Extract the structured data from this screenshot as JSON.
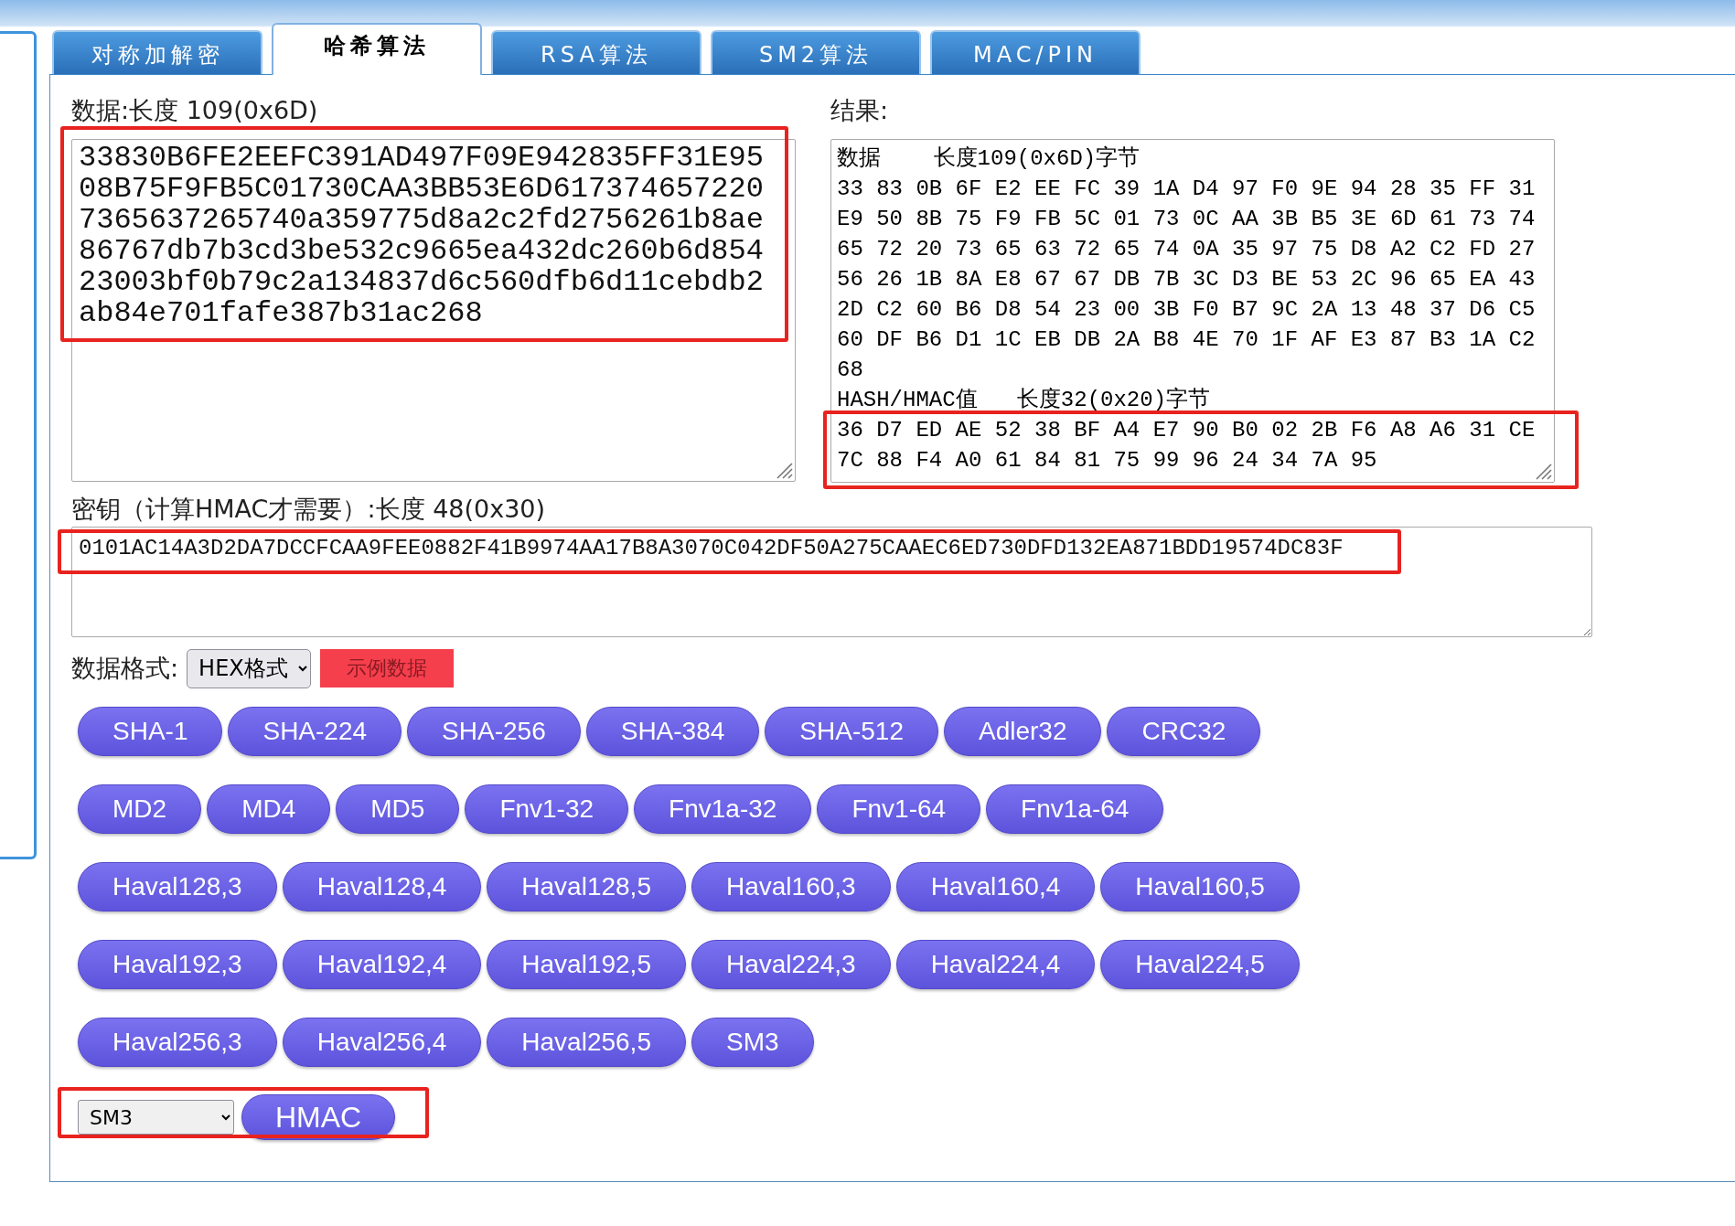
{
  "tabs": [
    {
      "label": "对称加解密",
      "selected": false
    },
    {
      "label": "哈希算法",
      "selected": true
    },
    {
      "label": "RSA算法",
      "selected": false
    },
    {
      "label": "SM2算法",
      "selected": false
    },
    {
      "label": "MAC/PIN",
      "selected": false
    }
  ],
  "data": {
    "label": "数据:长度 109(0x6D)",
    "value": "33830B6FE2EEFC391AD497F09E942835FF31E9508B75F9FB5C01730CAA3BB53E6D6173746572207365637265740a359775d8a2c2fd2756261b8ae86767db7b3cd3be532c9665ea432dc260b6d85423003bf0b79c2a134837d6c560dfb6d11cebdb2ab84e701fafe387b31ac268",
    "highlighted": true
  },
  "result": {
    "label": "结果:",
    "data_header": "数据    长度109(0x6D)字节",
    "data_lines": [
      "33 83 0B 6F E2 EE FC 39 1A D4 97 F0 9E 94 28 35 FF 31",
      "E9 50 8B 75 F9 FB 5C 01 73 0C AA 3B B5 3E 6D 61 73 74",
      "65 72 20 73 65 63 72 65 74 0A 35 97 75 D8 A2 C2 FD 27",
      "56 26 1B 8A E8 67 67 DB 7B 3C D3 BE 53 2C 96 65 EA 43",
      "2D C2 60 B6 D8 54 23 00 3B F0 B7 9C 2A 13 48 37 D6 C5",
      "60 DF B6 D1 1C EB DB 2A B8 4E 70 1F AF E3 87 B3 1A C2",
      "68"
    ],
    "hash_header": "HASH/HMAC值   长度32(0x20)字节",
    "hash_lines": [
      "36 D7 ED AE 52 38 BF A4 E7 90 B0 02 2B F6 A8 A6 31 CE",
      "7C 88 F4 A0 61 84 81 75 99 96 24 34 7A 95"
    ],
    "highlighted": true
  },
  "key": {
    "label": "密钥（计算HMAC才需要）:长度 48(0x30)",
    "value": "0101AC14A3D2DA7DCCFCAA9FEE0882F41B9974AA17B8A3070C042DF50A275CAAEC6ED730DFD132EA871BDD19574DC83F",
    "highlighted": true
  },
  "format": {
    "label": "数据格式:",
    "value": "HEX格式",
    "sample_button": "示例数据"
  },
  "hash_buttons": [
    [
      "SHA-1",
      "SHA-224",
      "SHA-256",
      "SHA-384",
      "SHA-512",
      "Adler32",
      "CRC32"
    ],
    [
      "MD2",
      "MD4",
      "MD5",
      "Fnv1-32",
      "Fnv1a-32",
      "Fnv1-64",
      "Fnv1a-64"
    ],
    [
      "Haval128,3",
      "Haval128,4",
      "Haval128,5",
      "Haval160,3",
      "Haval160,4",
      "Haval160,5"
    ],
    [
      "Haval192,3",
      "Haval192,4",
      "Haval192,5",
      "Haval224,3",
      "Haval224,4",
      "Haval224,5"
    ],
    [
      "Haval256,3",
      "Haval256,4",
      "Haval256,5",
      "SM3"
    ]
  ],
  "hmac": {
    "algorithm": "SM3",
    "button": "HMAC",
    "highlighted": true
  }
}
